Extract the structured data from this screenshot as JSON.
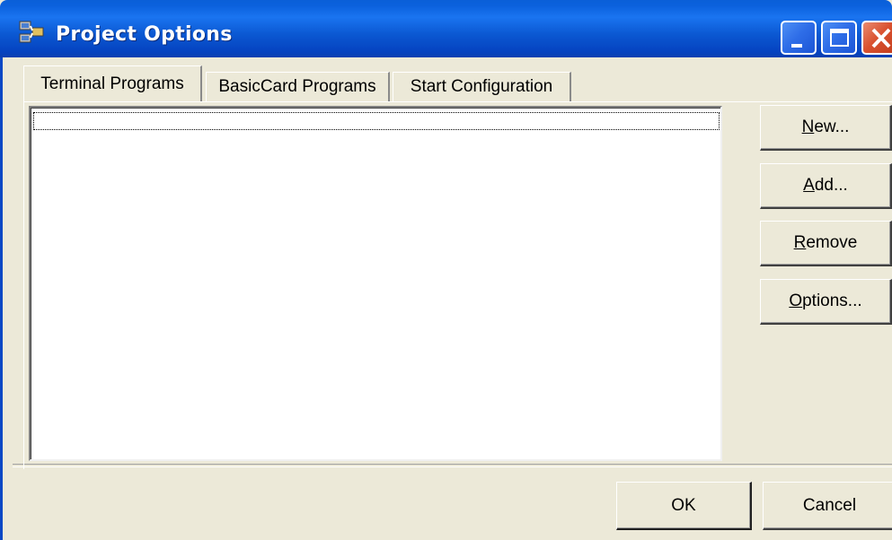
{
  "window": {
    "title": "Project Options",
    "app_icon": "project-options-icon",
    "controls": [
      "minimize-icon",
      "maximize-icon",
      "close-icon"
    ]
  },
  "tabs": [
    {
      "label": "Terminal Programs",
      "active": true
    },
    {
      "label": "BasicCard Programs",
      "active": false
    },
    {
      "label": "Start Configuration",
      "active": false
    }
  ],
  "list": {
    "items": []
  },
  "side_buttons": {
    "new": {
      "mnemonic": "N",
      "rest": "ew..."
    },
    "add": {
      "mnemonic": "A",
      "rest": "dd..."
    },
    "remove": {
      "mnemonic": "R",
      "rest": "emove"
    },
    "options": {
      "mnemonic": "O",
      "rest": "ptions..."
    }
  },
  "footer": {
    "ok_label": "OK",
    "cancel_label": "Cancel"
  },
  "colors": {
    "titlebar": "#0b5bd6",
    "dialog_face": "#ece9d8",
    "close_button": "#d9512f"
  }
}
